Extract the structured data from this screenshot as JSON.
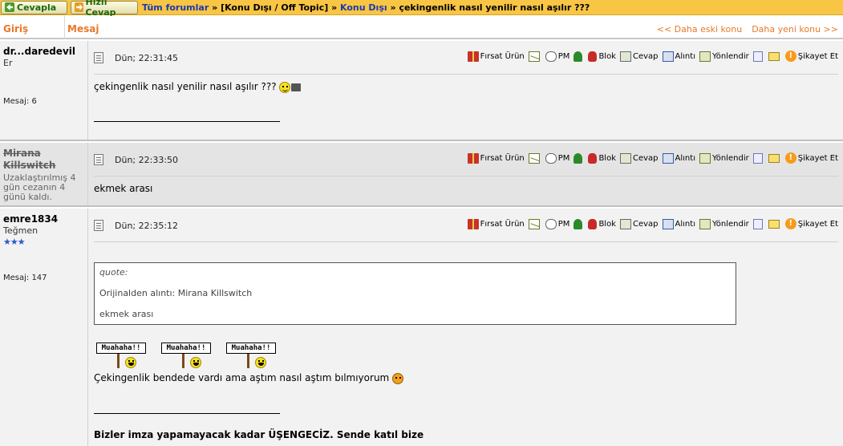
{
  "toolbar": {
    "reply_label": "Cevapla",
    "quick_reply_label": "Hızlı Cevap"
  },
  "breadcrumb": {
    "all_forums": "Tüm forumlar",
    "sep1": "»",
    "section": "[Konu Dışı / Off Topic]",
    "sep2": "»",
    "subforum": "Konu Dışı",
    "sep3": "»",
    "topic": "çekingenlik nasıl yenilir nasıl aşılır ???"
  },
  "header": {
    "col_user": "Giriş",
    "col_message": "Mesaj",
    "older_topic": "<< Daha eski konu",
    "newer_topic": "Daha yeni konu >>"
  },
  "actions": {
    "gift": "Fırsat Ürün",
    "pm": "PM",
    "block": "Blok",
    "reply": "Cevap",
    "quote": "Alıntı",
    "forward": "Yönlendir",
    "report": "Şikayet Et"
  },
  "posts": [
    {
      "username": "dr...daredevil",
      "rank": "Er",
      "message_count": "Mesaj: 6",
      "date": "Dün; 22:31:45",
      "text": "çekingenlik nasıl yenilir nasıl aşılır ???"
    },
    {
      "username": "Mirana Killswitch",
      "status": "Uzaklaştırılmış 4 gün cezanın 4 günü kaldı.",
      "date": "Dün; 22:33:50",
      "text": "ekmek arası"
    },
    {
      "username": "emre1834",
      "rank": "Teğmen",
      "message_count": "Mesaj: 147",
      "date": "Dün; 22:35:12",
      "quote_header": "quote:",
      "quote_attribution": "Orijinalden alıntı: Mirana Killswitch",
      "quote_text": "ekmek arası",
      "sign_text": "Muahaha!!",
      "text": "Çekingenlik bendede vardı ama aştım nasıl aştım bılmıyorum",
      "signature": "Bizler imza yapamayacak kadar ÜŞENGECİZ. Sende katıl bize"
    }
  ],
  "colors": {
    "topbar": "#f8c545",
    "header_accent": "#e8782a",
    "banned_row": "#e4e4e4",
    "post_bg": "#f2f2f2",
    "link": "#1a3ab0"
  }
}
